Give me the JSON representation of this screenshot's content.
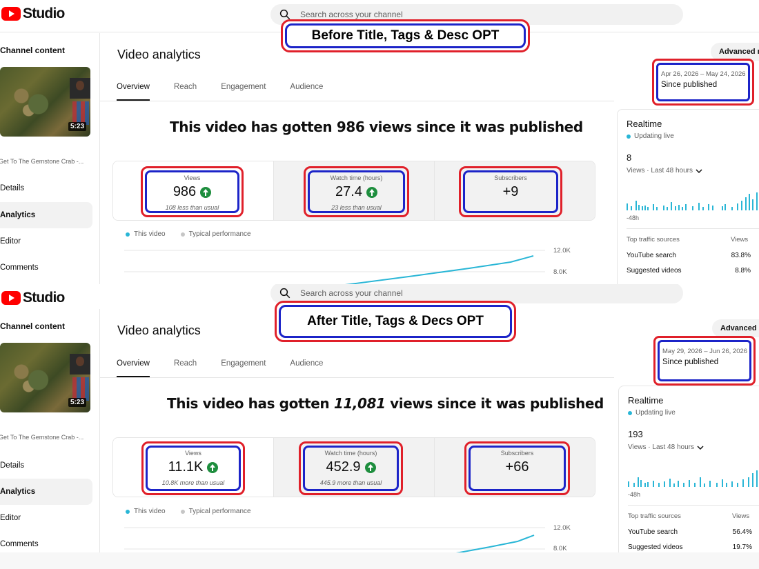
{
  "app": {
    "logo_text": "Studio"
  },
  "colors": {
    "brand_red": "#ff0000",
    "highlight_red": "#e0202a",
    "highlight_blue": "#1c24c8",
    "chart_line": "#29b6d6",
    "positive_green": "#1e8e3e"
  },
  "before": {
    "search_placeholder": "Search across your channel",
    "banner": "Before Title, Tags & Desc OPT",
    "sidebar": {
      "heading": "Channel content",
      "duration": "5:23",
      "video_title": "Get To The Gemstone Crab -...",
      "items": [
        "Details",
        "Analytics",
        "Editor",
        "Comments"
      ]
    },
    "page_title": "Video analytics",
    "tabs": [
      "Overview",
      "Reach",
      "Engagement",
      "Audience"
    ],
    "advanced": "Advanced m",
    "date_range": "Apr 26, 2026 – May 24, 2026",
    "since": "Since published",
    "headline_pre": "This video has gotten ",
    "headline_num": "986",
    "headline_post": " views since it was published",
    "metrics": [
      {
        "label": "Views",
        "value": "986",
        "sub": "108 less than usual",
        "arrow": true
      },
      {
        "label": "Watch time (hours)",
        "value": "27.4",
        "sub": "23 less than usual",
        "arrow": true
      },
      {
        "label": "Subscribers",
        "value": "+9",
        "sub": "",
        "arrow": false
      }
    ],
    "legend": [
      "This video",
      "Typical performance"
    ],
    "axis": [
      "12.0K",
      "8.0K"
    ],
    "realtime": {
      "title": "Realtime",
      "live": "Updating live",
      "count": "8",
      "period": "Views · Last 48 hours",
      "axis": "-48h",
      "sources_header": "Top traffic sources",
      "views_header": "Views",
      "rows": [
        {
          "name": "YouTube search",
          "pct": "83.8%"
        },
        {
          "name": "Suggested videos",
          "pct": "8.8%"
        }
      ]
    }
  },
  "after": {
    "search_placeholder": "Search across your channel",
    "banner": "After Title, Tags & Decs OPT",
    "sidebar": {
      "heading": "Channel content",
      "duration": "5:23",
      "video_title": "Get To The Gemstone Crab -...",
      "items": [
        "Details",
        "Analytics",
        "Editor",
        "Comments"
      ]
    },
    "page_title": "Video analytics",
    "tabs": [
      "Overview",
      "Reach",
      "Engagement",
      "Audience"
    ],
    "advanced": "Advanced m",
    "date_range": "May 29, 2026 – Jun 26, 2026",
    "since": "Since published",
    "headline_pre": "This video has gotten ",
    "headline_num": "11,081",
    "headline_post": " views since it was published",
    "metrics": [
      {
        "label": "Views",
        "value": "11.1K",
        "sub": "10.8K more than usual",
        "arrow": true
      },
      {
        "label": "Watch time (hours)",
        "value": "452.9",
        "sub": "445.9 more than usual",
        "arrow": true
      },
      {
        "label": "Subscribers",
        "value": "+66",
        "sub": "",
        "arrow": false
      }
    ],
    "legend": [
      "This video",
      "Typical performance"
    ],
    "axis": [
      "12.0K",
      "8.0K"
    ],
    "realtime": {
      "title": "Realtime",
      "live": "Updating live",
      "count": "193",
      "period": "Views · Last 48 hours",
      "axis": "-48h",
      "sources_header": "Top traffic sources",
      "views_header": "Views",
      "rows": [
        {
          "name": "YouTube search",
          "pct": "56.4%"
        },
        {
          "name": "Suggested videos",
          "pct": "19.7%"
        }
      ]
    }
  }
}
